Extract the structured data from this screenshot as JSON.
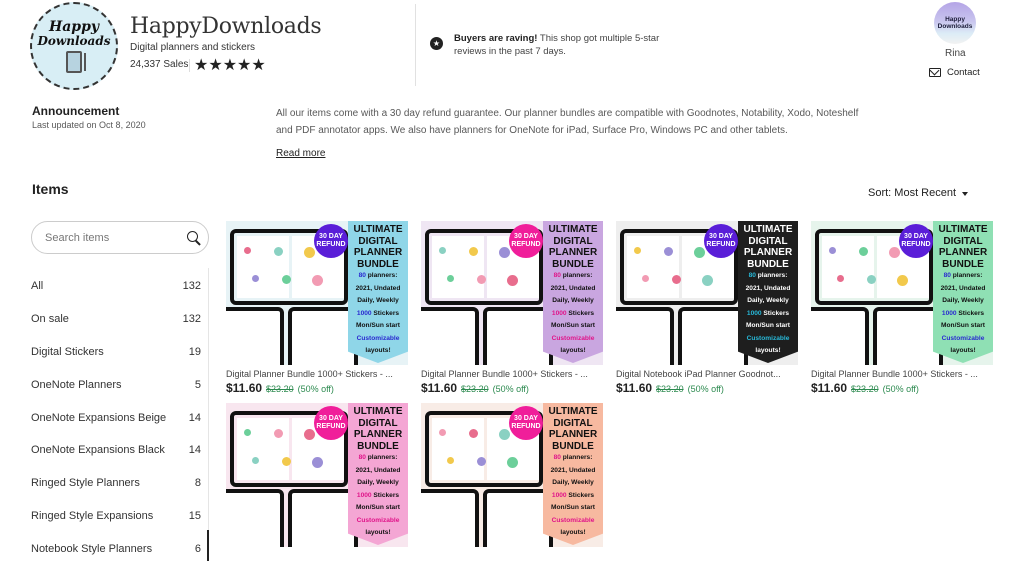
{
  "shop": {
    "logo_line1": "Happy",
    "logo_line2": "Downloads",
    "name": "HappyDownloads",
    "tagline": "Digital planners and stickers",
    "sales": "24,337 Sales",
    "rating_stars": "★★★★★",
    "rating": 5
  },
  "rave": {
    "icon": "star-badge-icon",
    "bold": "Buyers are raving!",
    "text": " This shop got multiple 5-star reviews in the past 7 days."
  },
  "owner": {
    "avatar_line1": "Happy",
    "avatar_line2": "Downloads",
    "name": "Rina",
    "contact_label": "Contact",
    "contact_icon": "mail-icon"
  },
  "announcement": {
    "title": "Announcement",
    "date": "Last updated on Oct 8, 2020",
    "body": "All our items come with a 30 day refund guarantee. Our planner bundles are compatible with Goodnotes, Notability, Xodo, Noteshelf and PDF annotator apps. We also have planners for OneNote for iPad, Surface Pro, Windows PC and other tablets.",
    "read_more": "Read more"
  },
  "items": {
    "title": "Items",
    "sort_label": "Sort: Most Recent",
    "search_placeholder": "Search items",
    "search_value": "",
    "categories": [
      {
        "label": "All",
        "count": "132"
      },
      {
        "label": "On sale",
        "count": "132"
      },
      {
        "label": "Digital Stickers",
        "count": "19"
      },
      {
        "label": "OneNote Planners",
        "count": "5"
      },
      {
        "label": "OneNote Expansions Beige",
        "count": "14"
      },
      {
        "label": "OneNote Expansions Black",
        "count": "14"
      },
      {
        "label": "Ringed Style Planners",
        "count": "8"
      },
      {
        "label": "Ringed Style Expansions",
        "count": "15"
      },
      {
        "label": "Notebook Style Planners",
        "count": "6"
      }
    ]
  },
  "listings": [
    {
      "title": "Digital Planner Bundle 1000+ Stickers - ...",
      "price": "$11.60",
      "original_price": "$23.20",
      "discount": "(50% off)",
      "banner_color": "#8fd6e8",
      "banner_text_color": "#111111",
      "accent_color": "#2a2ad0",
      "badge_color": "#5a1ed8",
      "bg_tint": "#e7f3f6"
    },
    {
      "title": "Digital Planner Bundle 1000+ Stickers - ...",
      "price": "$11.60",
      "original_price": "$23.20",
      "discount": "(50% off)",
      "banner_color": "#c9a6e0",
      "banner_text_color": "#111111",
      "accent_color": "#e0158a",
      "badge_color": "#f01e9a",
      "bg_tint": "#efe6f3"
    },
    {
      "title": "Digital Notebook iPad Planner Goodnot...",
      "price": "$11.60",
      "original_price": "$23.20",
      "discount": "(50% off)",
      "banner_color": "#1e1e1e",
      "banner_text_color": "#ffffff",
      "accent_color": "#27b8d8",
      "badge_color": "#5a1ed8",
      "bg_tint": "#eeeeee"
    },
    {
      "title": "Digital Planner Bundle 1000+ Stickers - ...",
      "price": "$11.60",
      "original_price": "$23.20",
      "discount": "(50% off)",
      "banner_color": "#8fe0b4",
      "banner_text_color": "#111111",
      "accent_color": "#2a2ad0",
      "badge_color": "#5a1ed8",
      "bg_tint": "#e6f4ec"
    },
    {
      "title": "",
      "price": "",
      "original_price": "",
      "discount": "",
      "banner_color": "#f4a6d4",
      "banner_text_color": "#111111",
      "accent_color": "#e0158a",
      "badge_color": "#f01e9a",
      "bg_tint": "#f8e6ef"
    },
    {
      "title": "",
      "price": "",
      "original_price": "",
      "discount": "",
      "banner_color": "#f7b9a0",
      "banner_text_color": "#111111",
      "accent_color": "#e0158a",
      "badge_color": "#f01e9a",
      "bg_tint": "#f8ece6"
    }
  ],
  "banner": {
    "badge": "30 DAY REFUND",
    "badge_line1": "30 DAY",
    "badge_line2": "REFUND",
    "title_lines": [
      "ULTIMATE",
      "DIGITAL",
      "PLANNER",
      "BUNDLE"
    ],
    "line1_accent": "80",
    "line1_rest": " planners:",
    "line2": "2021, Undated",
    "line3": "Daily, Weekly",
    "line4_accent": "1000",
    "line4_rest": " Stickers",
    "line5": "Mon/Sun start",
    "line6_accent": "Customizable",
    "line7": "layouts!"
  }
}
